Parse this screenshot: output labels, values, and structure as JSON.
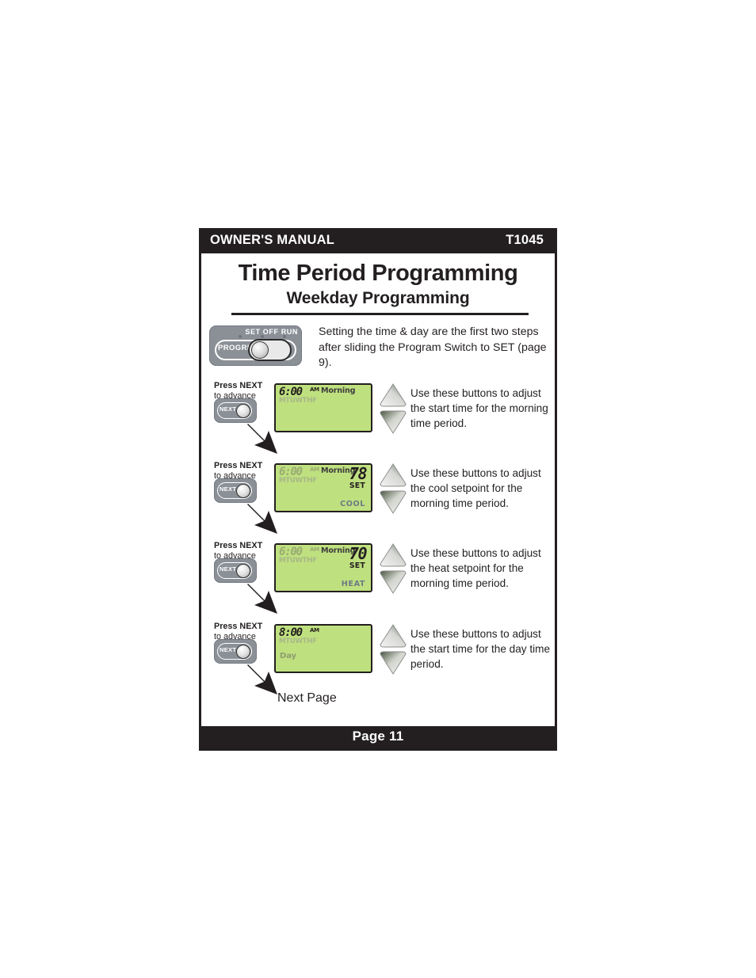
{
  "header": {
    "manual_label": "OWNER'S MANUAL",
    "model": "T1045"
  },
  "titles": {
    "main": "Time Period Programming",
    "sub": "Weekday Programming"
  },
  "program_switch": {
    "positions": "SET  OFF  RUN",
    "knob_label": "PROGRM",
    "intro_text": "Setting the time & day are the first two steps after sliding the Program Switch to SET (page 9)."
  },
  "rows": [
    {
      "press_label_line1": "Press NEXT",
      "press_label_line2": "to advance",
      "button_label": "NEXT",
      "lcd": {
        "time": "6:00",
        "ampm": "AM",
        "time_dim": false,
        "period": "Morning",
        "days": "MTUWTHF",
        "temp": "",
        "set_label": "",
        "mode": "",
        "dayword": ""
      },
      "instruction": "Use these buttons to adjust the start time for the morning time period."
    },
    {
      "press_label_line1": "Press NEXT",
      "press_label_line2": "to advance",
      "button_label": "NEXT",
      "lcd": {
        "time": "6:00",
        "ampm": "AM",
        "time_dim": true,
        "period": "Morning",
        "days": "MTUWTHF",
        "temp": "78",
        "set_label": "SET",
        "mode": "COOL",
        "dayword": ""
      },
      "instruction": "Use these buttons to adjust the cool setpoint for the morning time period."
    },
    {
      "press_label_line1": "Press NEXT",
      "press_label_line2": "to advance",
      "button_label": "NEXT",
      "lcd": {
        "time": "6:00",
        "ampm": "AM",
        "time_dim": true,
        "period": "Morning",
        "days": "MTUWTHF",
        "temp": "70",
        "set_label": "SET",
        "mode": "HEAT",
        "dayword": ""
      },
      "instruction": "Use these buttons to adjust the heat setpoint for the morning time period."
    },
    {
      "press_label_line1": "Press NEXT",
      "press_label_line2": "to advance",
      "button_label": "NEXT",
      "lcd": {
        "time": "8:00",
        "ampm": "AM",
        "time_dim": false,
        "period": "",
        "days": "MTUWTHF",
        "temp": "",
        "set_label": "",
        "mode": "",
        "dayword": "Day"
      },
      "instruction": "Use these buttons to adjust the start time for the day time period."
    }
  ],
  "next_page_label": "Next Page",
  "footer": {
    "page_label": "Page 11"
  },
  "colors": {
    "ink": "#231f20",
    "lcd_green": "#bfe07f",
    "lcd_dim": "#a8b887",
    "mode_grey": "#6e7a85",
    "device_grey": "#8b9097"
  }
}
